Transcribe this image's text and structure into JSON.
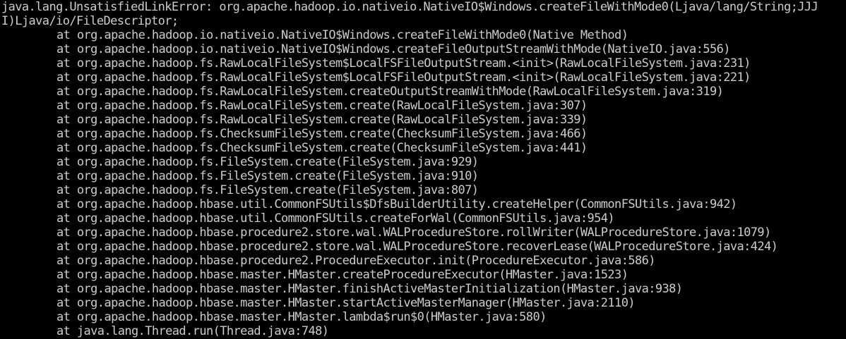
{
  "console": {
    "background_color": "#000000",
    "text_color": "#cccccc",
    "error_line_1": "java.lang.UnsatisfiedLinkError: org.apache.hadoop.io.nativeio.NativeIO$Windows.createFileWithMode0(Ljava/lang/String;JJJ",
    "error_line_2": "I)Ljava/io/FileDescriptor;",
    "frames": [
      "at org.apache.hadoop.io.nativeio.NativeIO$Windows.createFileWithMode0(Native Method)",
      "at org.apache.hadoop.io.nativeio.NativeIO$Windows.createFileOutputStreamWithMode(NativeIO.java:556)",
      "at org.apache.hadoop.fs.RawLocalFileSystem$LocalFSFileOutputStream.<init>(RawLocalFileSystem.java:231)",
      "at org.apache.hadoop.fs.RawLocalFileSystem$LocalFSFileOutputStream.<init>(RawLocalFileSystem.java:221)",
      "at org.apache.hadoop.fs.RawLocalFileSystem.createOutputStreamWithMode(RawLocalFileSystem.java:319)",
      "at org.apache.hadoop.fs.RawLocalFileSystem.create(RawLocalFileSystem.java:307)",
      "at org.apache.hadoop.fs.RawLocalFileSystem.create(RawLocalFileSystem.java:339)",
      "at org.apache.hadoop.fs.ChecksumFileSystem.create(ChecksumFileSystem.java:466)",
      "at org.apache.hadoop.fs.ChecksumFileSystem.create(ChecksumFileSystem.java:441)",
      "at org.apache.hadoop.fs.FileSystem.create(FileSystem.java:929)",
      "at org.apache.hadoop.fs.FileSystem.create(FileSystem.java:910)",
      "at org.apache.hadoop.fs.FileSystem.create(FileSystem.java:807)",
      "at org.apache.hadoop.hbase.util.CommonFSUtils$DfsBuilderUtility.createHelper(CommonFSUtils.java:942)",
      "at org.apache.hadoop.hbase.util.CommonFSUtils.createForWal(CommonFSUtils.java:954)",
      "at org.apache.hadoop.hbase.procedure2.store.wal.WALProcedureStore.rollWriter(WALProcedureStore.java:1079)",
      "at org.apache.hadoop.hbase.procedure2.store.wal.WALProcedureStore.recoverLease(WALProcedureStore.java:424)",
      "at org.apache.hadoop.hbase.procedure2.ProcedureExecutor.init(ProcedureExecutor.java:586)",
      "at org.apache.hadoop.hbase.master.HMaster.createProcedureExecutor(HMaster.java:1523)",
      "at org.apache.hadoop.hbase.master.HMaster.finishActiveMasterInitialization(HMaster.java:938)",
      "at org.apache.hadoop.hbase.master.HMaster.startActiveMasterManager(HMaster.java:2110)",
      "at org.apache.hadoop.hbase.master.HMaster.lambda$run$0(HMaster.java:580)",
      "at java.lang.Thread.run(Thread.java:748)"
    ]
  }
}
